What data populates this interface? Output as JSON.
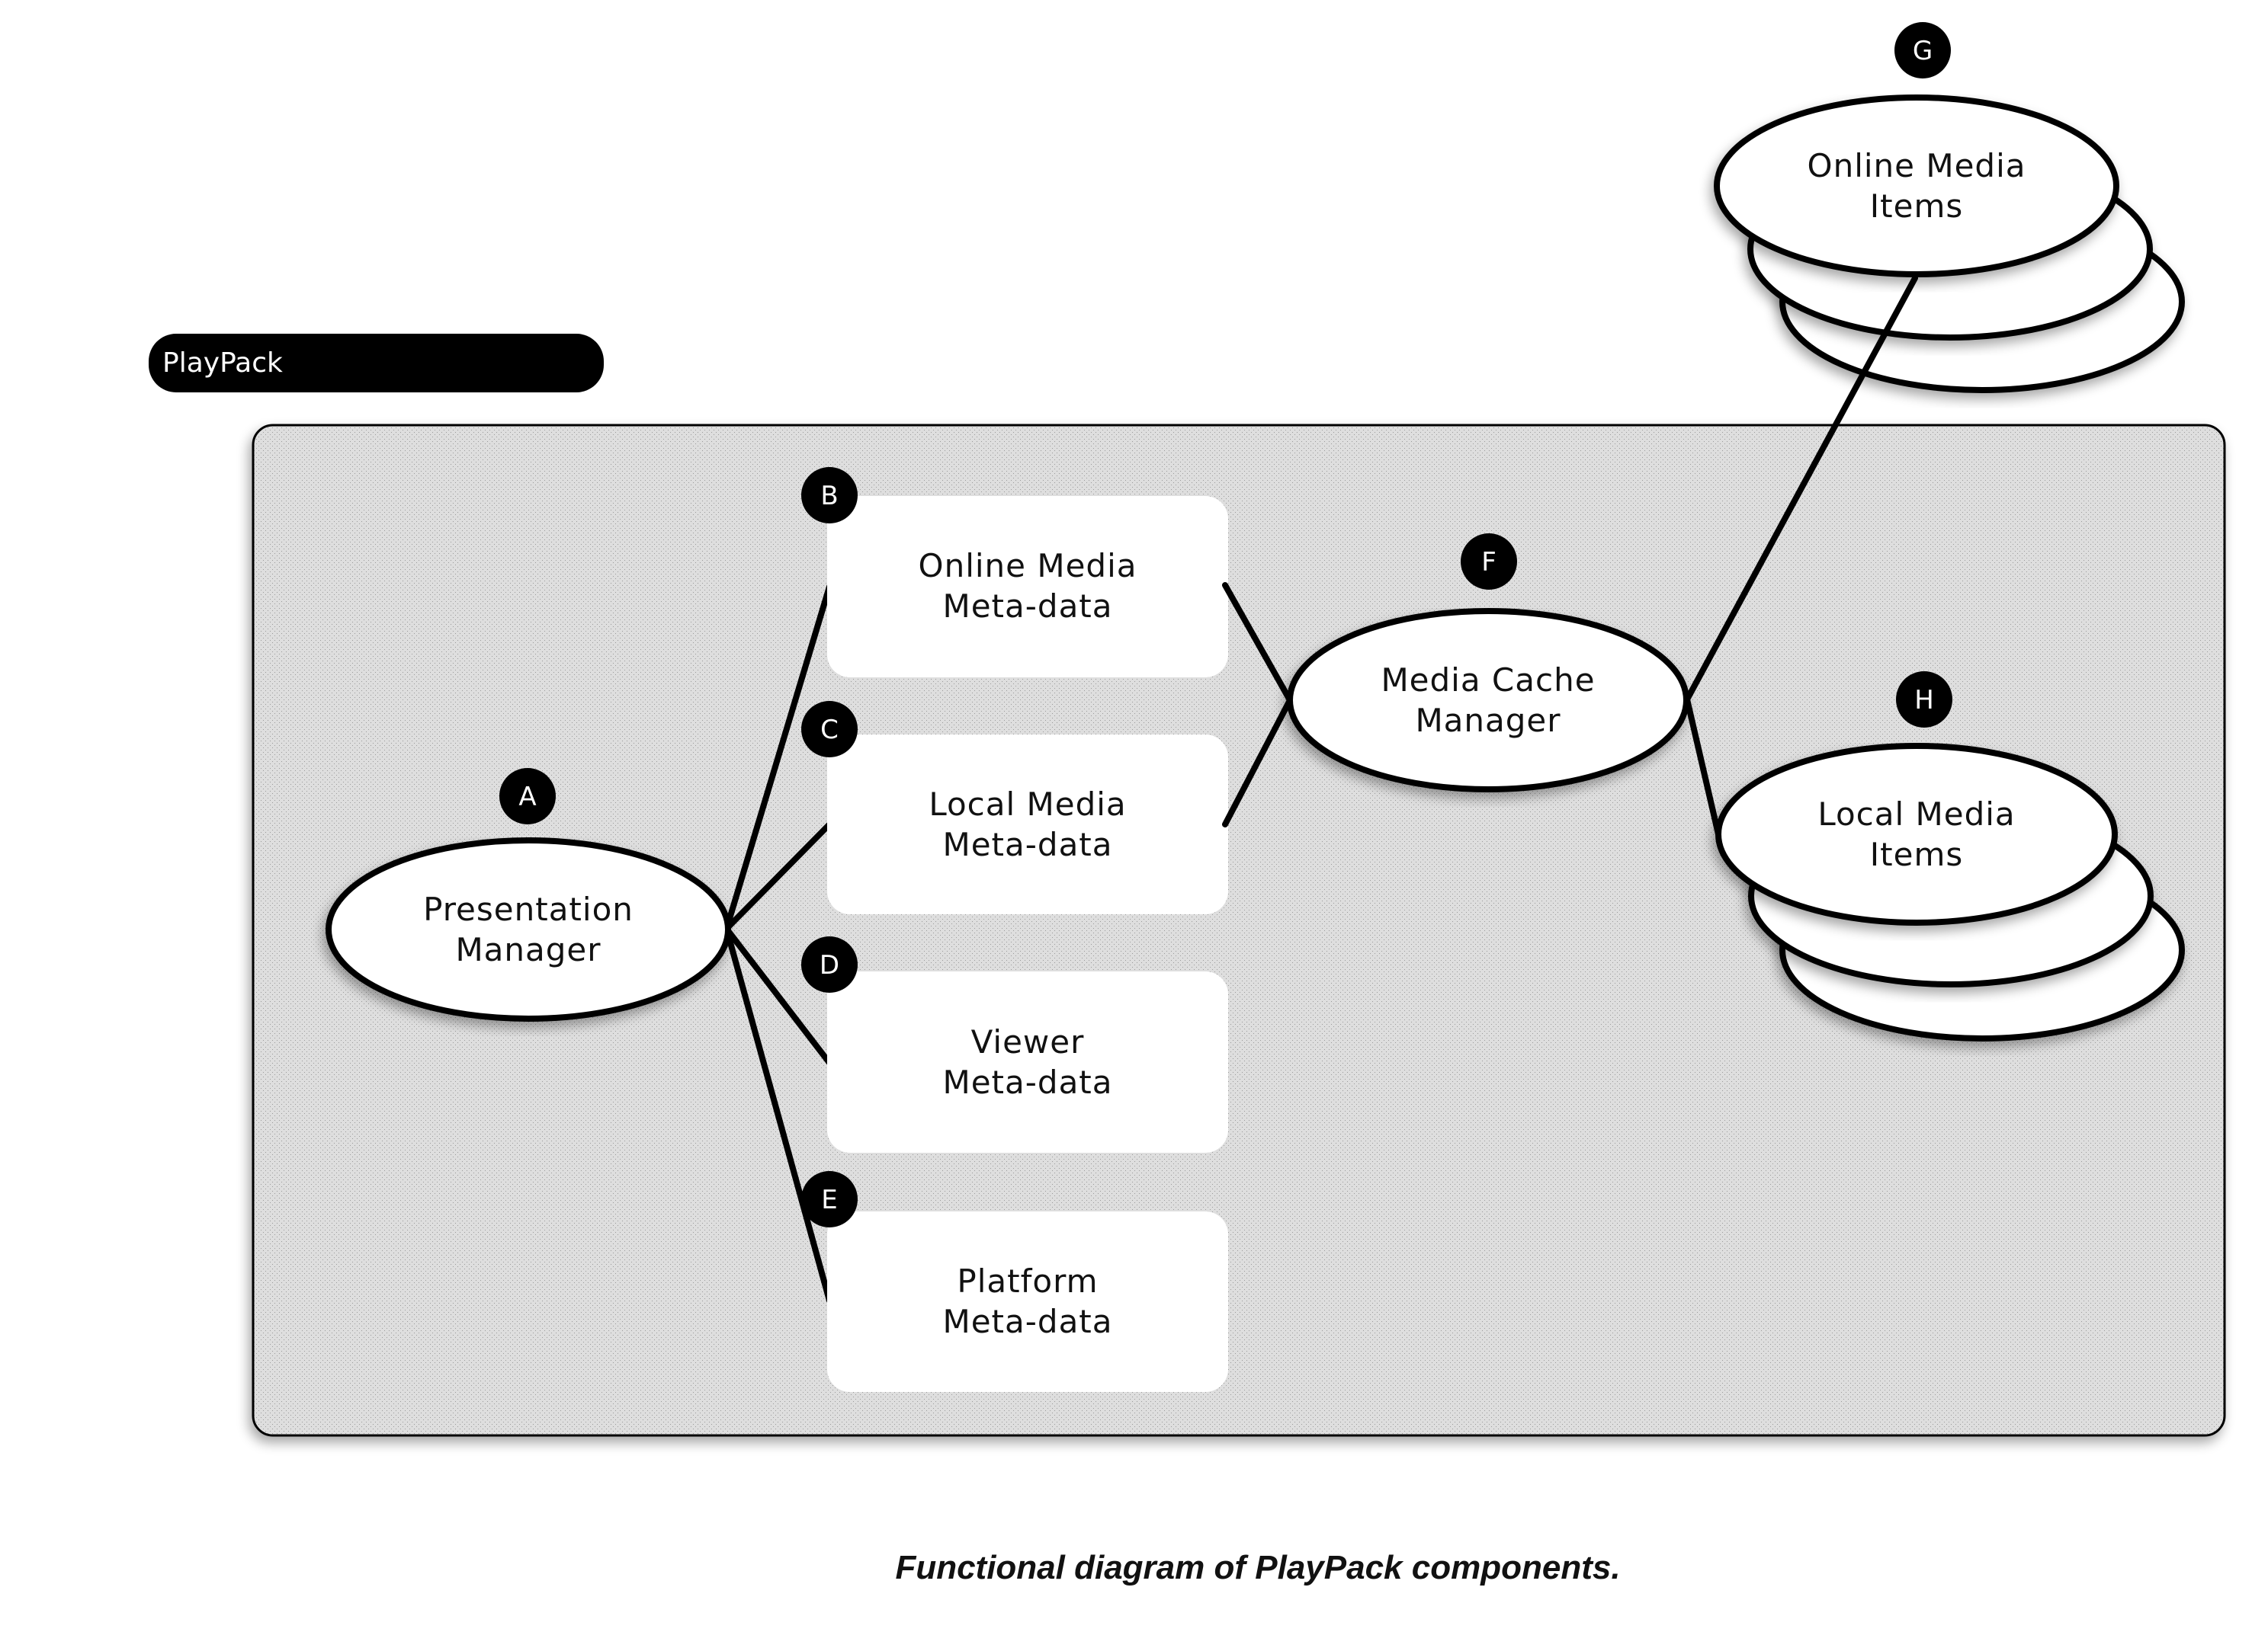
{
  "title_label": "PlayPack",
  "caption": "Functional diagram of PlayPack components.",
  "colors": {
    "label_bar": "#000000",
    "container_fill": "#dadada",
    "node_fill": "#ffffff",
    "stroke": "#000000",
    "badge": "#000000"
  },
  "nodes": {
    "A": {
      "badge": "A",
      "shape": "ellipse",
      "lines": [
        "Presentation",
        "Manager"
      ]
    },
    "B": {
      "badge": "B",
      "shape": "box",
      "lines": [
        "Online Media",
        "Meta-data"
      ]
    },
    "C": {
      "badge": "C",
      "shape": "box",
      "lines": [
        "Local Media",
        "Meta-data"
      ]
    },
    "D": {
      "badge": "D",
      "shape": "box",
      "lines": [
        "Viewer",
        "Meta-data"
      ]
    },
    "E": {
      "badge": "E",
      "shape": "box",
      "lines": [
        "Platform",
        "Meta-data"
      ]
    },
    "F": {
      "badge": "F",
      "shape": "ellipse",
      "lines": [
        "Media Cache",
        "Manager"
      ]
    },
    "G": {
      "badge": "G",
      "shape": "stacked-ellipse",
      "lines": [
        "Online Media",
        "Items"
      ]
    },
    "H": {
      "badge": "H",
      "shape": "stacked-ellipse",
      "lines": [
        "Local Media",
        "Items"
      ]
    }
  },
  "edges": [
    {
      "from": "A",
      "to": "B"
    },
    {
      "from": "A",
      "to": "C"
    },
    {
      "from": "A",
      "to": "D"
    },
    {
      "from": "A",
      "to": "E"
    },
    {
      "from": "B",
      "to": "F"
    },
    {
      "from": "C",
      "to": "F"
    },
    {
      "from": "F",
      "to": "G"
    },
    {
      "from": "F",
      "to": "H"
    }
  ]
}
